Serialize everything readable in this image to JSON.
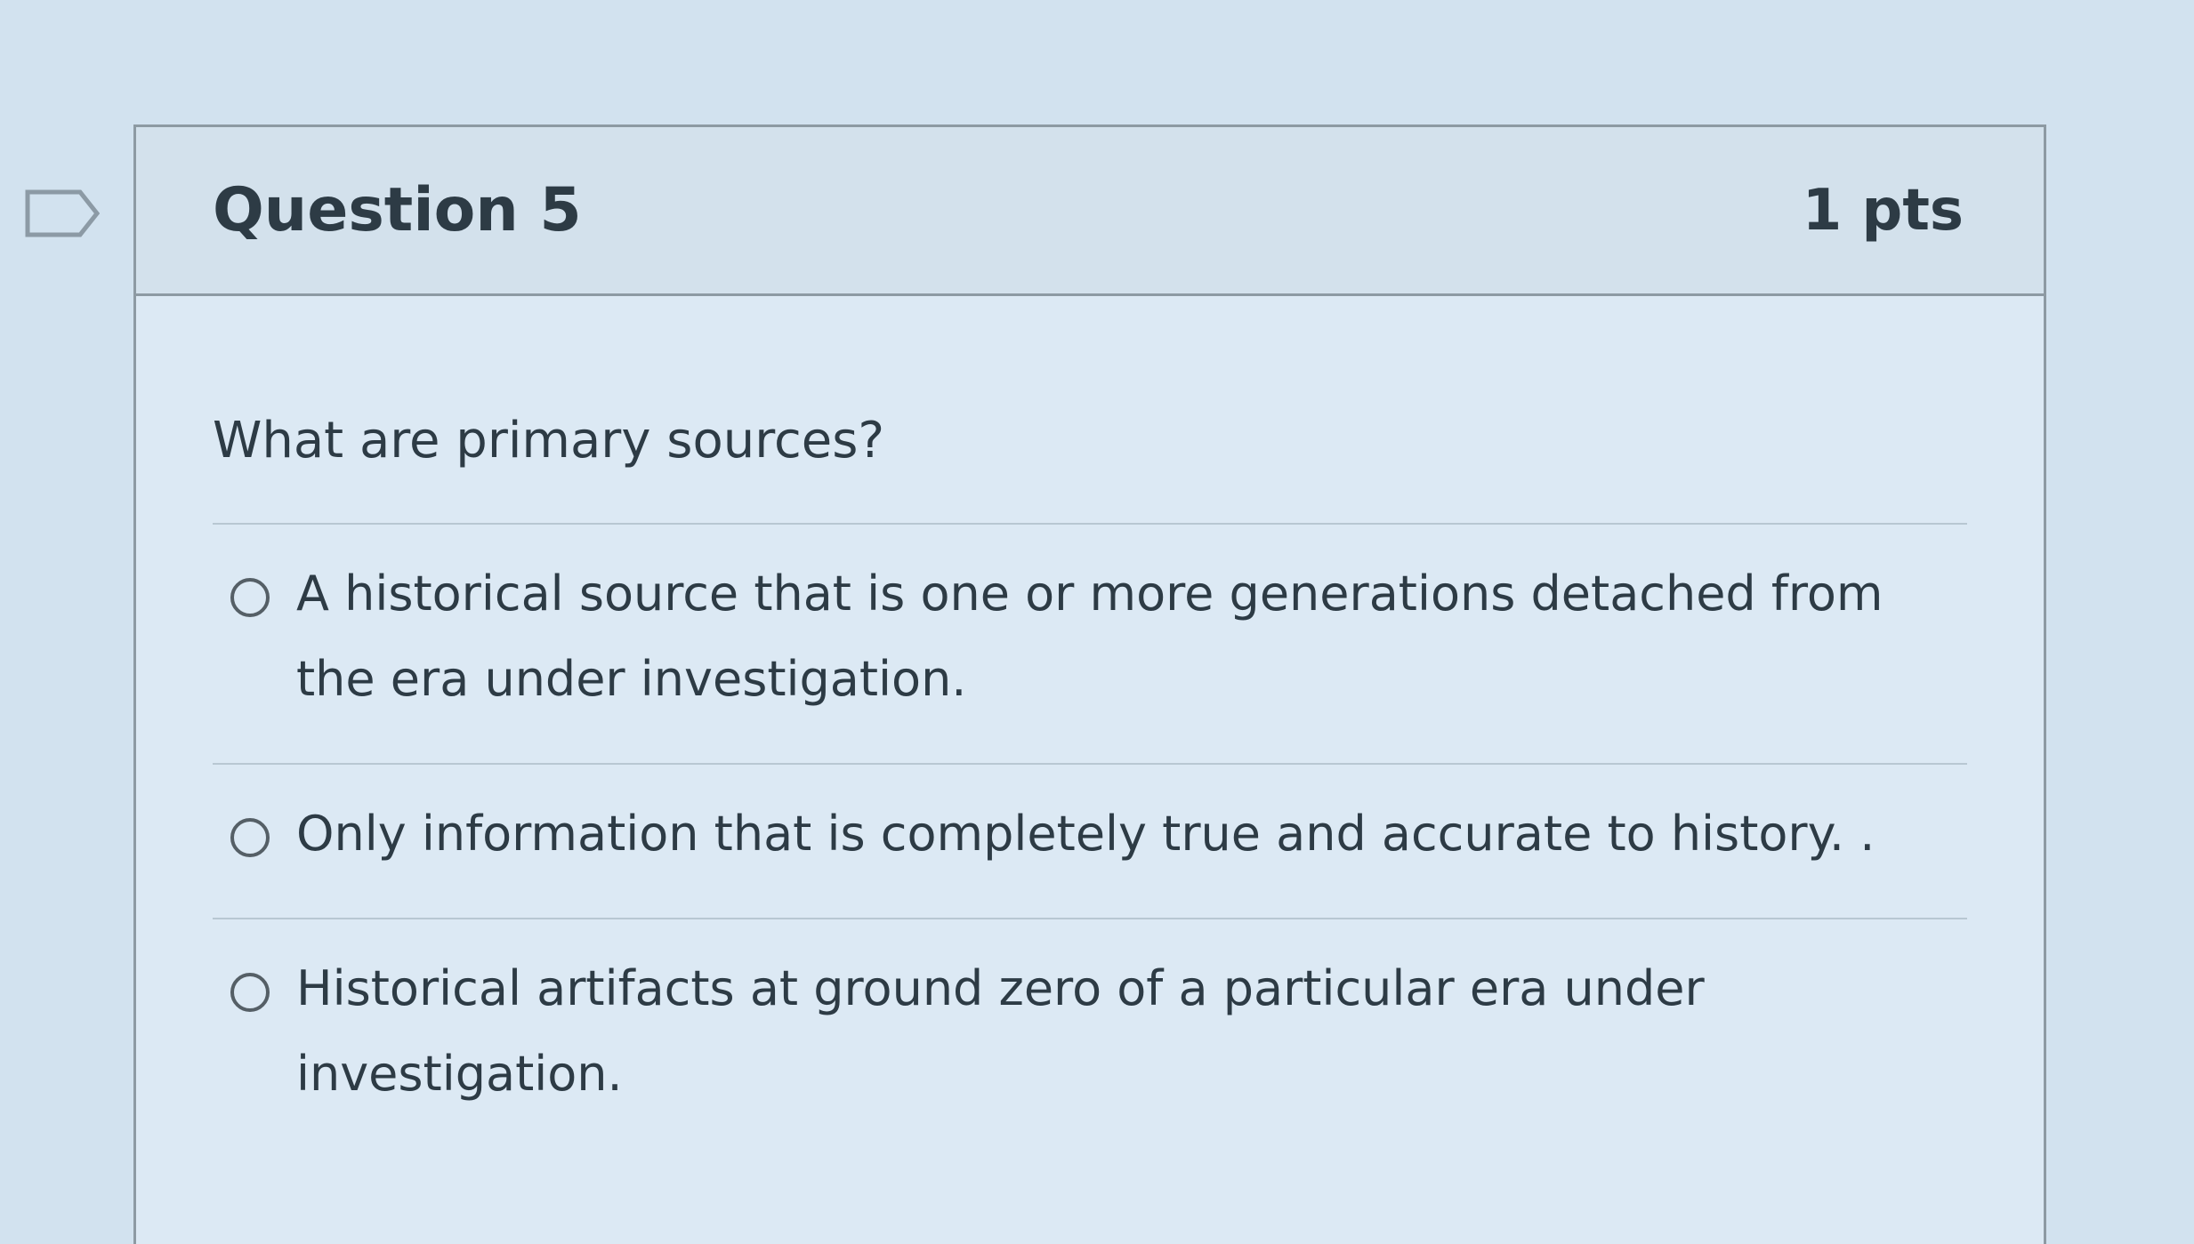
{
  "question": {
    "title": "Question 5",
    "points": "1 pts",
    "text": "What are primary sources?",
    "answers": [
      {
        "label": "A historical source that is one or more generations detached from the era under investigation."
      },
      {
        "label": "Only information that is completely true and accurate to history. ."
      },
      {
        "label": "Historical artifacts at ground zero of a particular era under investigation."
      }
    ]
  },
  "icons": {
    "flag": "flag-outline-icon",
    "radio": "radio-unselected-icon"
  },
  "colors": {
    "text": "#2d3b45",
    "border": "#8d9aa3",
    "header_bg": "#d3e1ec",
    "card_bg": "#dce9f4",
    "flag_stroke": "#8c9aa5"
  }
}
